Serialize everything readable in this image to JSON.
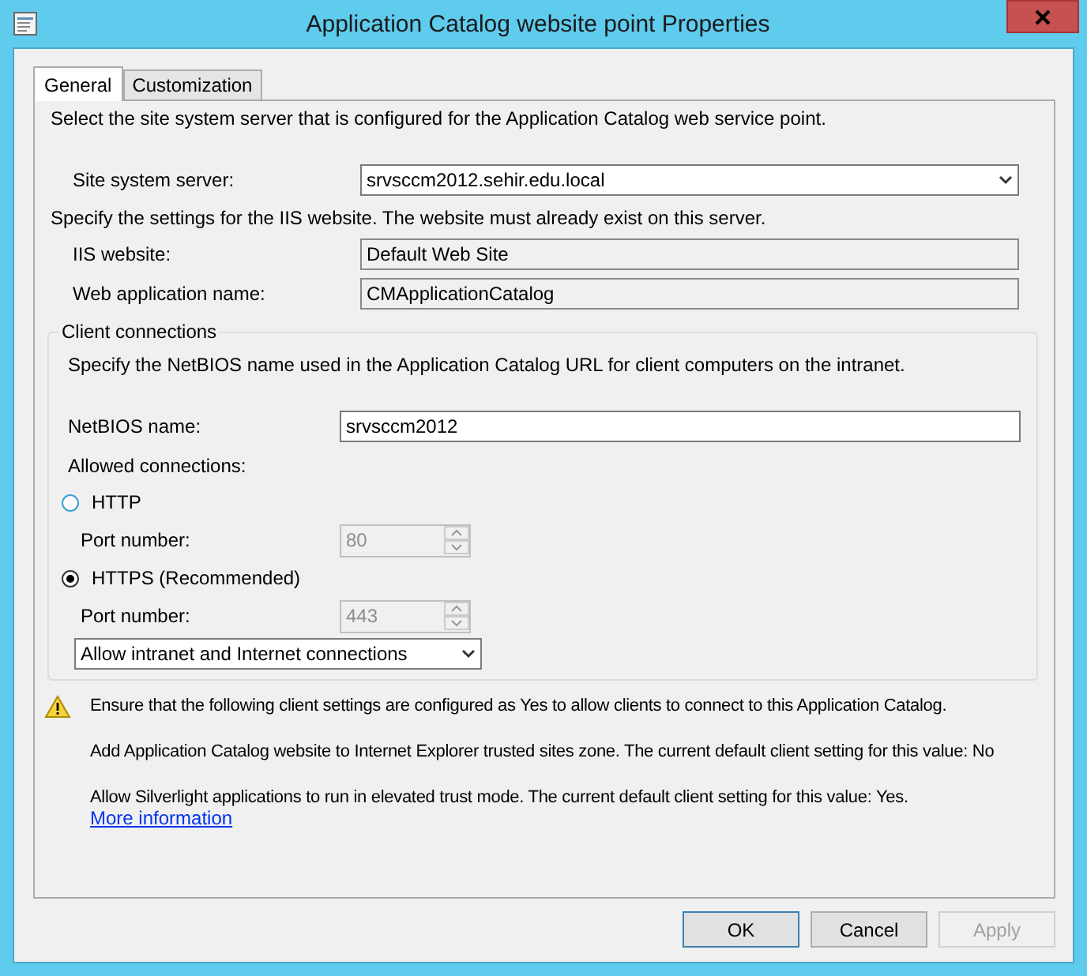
{
  "window": {
    "title": "Application Catalog website point Properties"
  },
  "tabs": [
    {
      "label": "General",
      "selected": true
    },
    {
      "label": "Customization",
      "selected": false
    }
  ],
  "general": {
    "intro": "Select the site system server that is configured for the Application Catalog web service point.",
    "site_server": {
      "label": "Site system server:",
      "value": "srvsccm2012.sehir.edu.local"
    },
    "iis_intro": "Specify the settings for the IIS website. The website must already exist on this server.",
    "iis_fields": [
      {
        "label": "IIS website:",
        "value": "Default Web Site",
        "disabled": true
      },
      {
        "label": "Web application name:",
        "value": "CMApplicationCatalog",
        "disabled": true
      }
    ],
    "client_connections": {
      "title": "Client connections",
      "intro": "Specify the NetBIOS name used in the Application Catalog URL for client computers on the intranet.",
      "netbios": {
        "label": "NetBIOS name:",
        "value": "srvsccm2012"
      },
      "allowed_label": "Allowed connections:",
      "options": [
        {
          "label": "HTTP",
          "selected": false,
          "port_label": "Port number:",
          "port_value": "80",
          "port_disabled": true
        },
        {
          "label": "HTTPS (Recommended)",
          "selected": true,
          "port_label": "Port number:",
          "port_value": "443",
          "port_disabled": true
        }
      ],
      "connection_scope": "Allow intranet and Internet connections"
    },
    "warning": {
      "lines": [
        "Ensure that the following client settings are configured as Yes to allow clients to connect to this Application Catalog.",
        "Add Application Catalog website to Internet Explorer trusted sites zone. The current default client setting for this value: No",
        "Allow Silverlight applications to run in elevated trust mode. The current default client setting for this value: Yes."
      ],
      "link": "More information"
    }
  },
  "buttons": [
    {
      "label": "OK",
      "disabled": false,
      "default": true
    },
    {
      "label": "Cancel",
      "disabled": false,
      "default": false
    },
    {
      "label": "Apply",
      "disabled": true,
      "default": false
    }
  ]
}
